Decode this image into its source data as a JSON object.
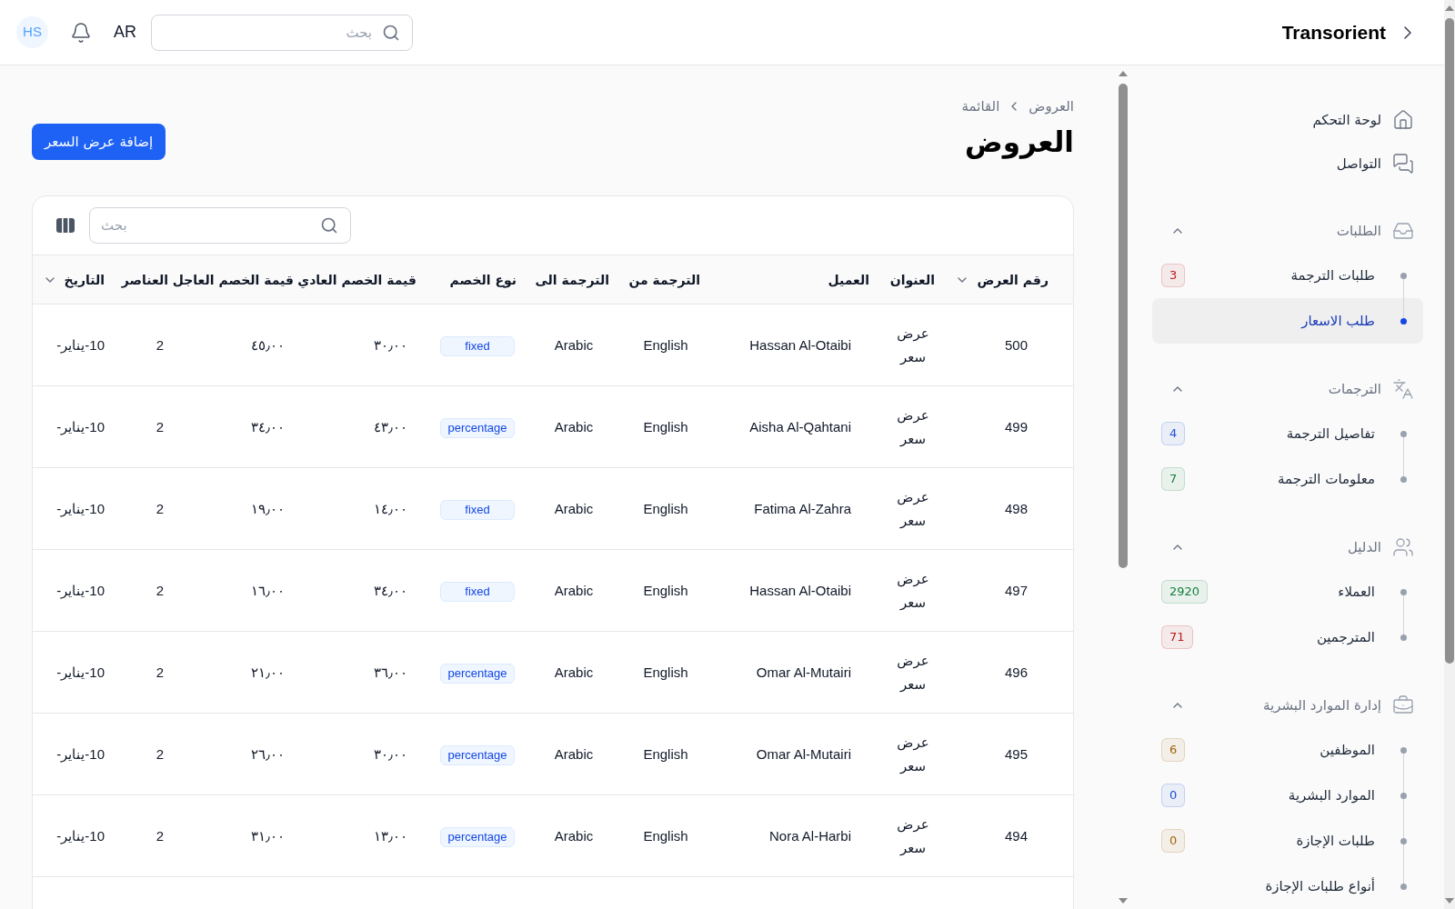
{
  "header": {
    "brand": "Transorient",
    "search": {
      "placeholder": "بحث"
    },
    "language": "AR",
    "avatar": "HS"
  },
  "sidebar": {
    "items": [
      {
        "label": "لوحة التحكم",
        "selected": false
      },
      {
        "label": "التواصل",
        "selected": false
      }
    ],
    "groups": [
      {
        "label": "الطلبات",
        "expanded": true,
        "children": [
          {
            "label": "طلبات الترجمة",
            "selected": false,
            "badge": {
              "text": "3",
              "color": "#b91c1c"
            }
          },
          {
            "label": "طلب الاسعار",
            "selected": true
          }
        ]
      },
      {
        "label": "الترجمات",
        "expanded": true,
        "children": [
          {
            "label": "تفاصيل الترجمة",
            "selected": false,
            "badge": {
              "text": "4",
              "color": "#1d4ed8"
            }
          },
          {
            "label": "معلومات الترجمة",
            "selected": false,
            "badge": {
              "text": "7",
              "color": "#15803d"
            }
          }
        ]
      },
      {
        "label": "الدليل",
        "expanded": true,
        "children": [
          {
            "label": "العملاء",
            "selected": false,
            "badge": {
              "text": "2920",
              "color": "#15803d"
            }
          },
          {
            "label": "المترجمين",
            "selected": false,
            "badge": {
              "text": "71",
              "color": "#b91c1c"
            }
          }
        ]
      },
      {
        "label": "إدارة الموارد البشرية",
        "expanded": true,
        "children": [
          {
            "label": "الموظفين",
            "selected": false,
            "badge": {
              "text": "6",
              "color": "#a16207"
            }
          },
          {
            "label": "الموارد البشرية",
            "selected": false,
            "badge": {
              "text": "0",
              "color": "#1d4ed8"
            }
          },
          {
            "label": "طلبات الإجازة",
            "selected": false,
            "badge": {
              "text": "0",
              "color": "#a16207"
            }
          },
          {
            "label": "أنواع طلبات الإجازة",
            "selected": false
          }
        ]
      }
    ]
  },
  "breadcrumb": [
    "العروض",
    "القائمة"
  ],
  "page_title": "العروض",
  "add_button": "إضافة عرض السعر",
  "table": {
    "search": {
      "placeholder": "بحث"
    },
    "columns": [
      {
        "label": "رقم العرض",
        "sortable": true
      },
      {
        "label": "العنوان",
        "sortable": false
      },
      {
        "label": "العميل",
        "sortable": false
      },
      {
        "label": "الترجمة من",
        "sortable": false
      },
      {
        "label": "الترجمة الى",
        "sortable": false
      },
      {
        "label": "نوع الخصم",
        "sortable": false
      },
      {
        "label": "قيمة الخصم العادي",
        "sortable": false
      },
      {
        "label": "قيمة الخصم العاجل",
        "sortable": false
      },
      {
        "label": "العناصر",
        "sortable": false
      },
      {
        "label": "التاريخ",
        "sortable": true
      }
    ],
    "rows": [
      {
        "number": "500",
        "title": "عرض سعر",
        "client": "Hassan Al-Otaibi",
        "from": "English",
        "to": "Arabic",
        "discount_type": "fixed",
        "normal": "٣٠٫٠٠",
        "urgent": "٤٥٫٠٠",
        "items": "2",
        "date": "10-يناير-"
      },
      {
        "number": "499",
        "title": "عرض سعر",
        "client": "Aisha Al-Qahtani",
        "from": "English",
        "to": "Arabic",
        "discount_type": "percentage",
        "normal": "٤٣٫٠٠",
        "urgent": "٣٤٫٠٠",
        "items": "2",
        "date": "10-يناير-"
      },
      {
        "number": "498",
        "title": "عرض سعر",
        "client": "Fatima Al-Zahra",
        "from": "English",
        "to": "Arabic",
        "discount_type": "fixed",
        "normal": "١٤٫٠٠",
        "urgent": "١٩٫٠٠",
        "items": "2",
        "date": "10-يناير-"
      },
      {
        "number": "497",
        "title": "عرض سعر",
        "client": "Hassan Al-Otaibi",
        "from": "English",
        "to": "Arabic",
        "discount_type": "fixed",
        "normal": "٣٤٫٠٠",
        "urgent": "١٦٫٠٠",
        "items": "2",
        "date": "10-يناير-"
      },
      {
        "number": "496",
        "title": "عرض سعر",
        "client": "Omar Al-Mutairi",
        "from": "English",
        "to": "Arabic",
        "discount_type": "percentage",
        "normal": "٣٦٫٠٠",
        "urgent": "٢١٫٠٠",
        "items": "2",
        "date": "10-يناير-"
      },
      {
        "number": "495",
        "title": "عرض سعر",
        "client": "Omar Al-Mutairi",
        "from": "English",
        "to": "Arabic",
        "discount_type": "percentage",
        "normal": "٣٠٫٠٠",
        "urgent": "٢٦٫٠٠",
        "items": "2",
        "date": "10-يناير-"
      },
      {
        "number": "494",
        "title": "عرض سعر",
        "client": "Nora Al-Harbi",
        "from": "English",
        "to": "Arabic",
        "discount_type": "percentage",
        "normal": "١٣٫٠٠",
        "urgent": "٣١٫٠٠",
        "items": "2",
        "date": "10-يناير-"
      }
    ]
  }
}
